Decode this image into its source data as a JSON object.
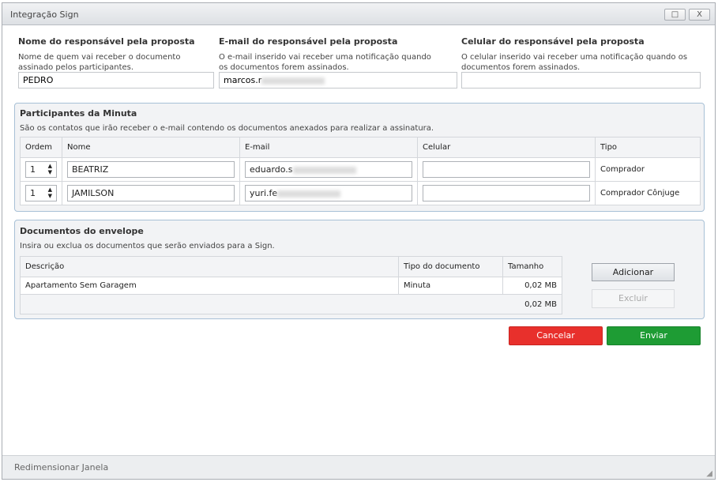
{
  "window": {
    "title": "Integração Sign",
    "maximize_icon": "□",
    "close_icon": "X"
  },
  "responsavel": {
    "nome": {
      "label": "Nome do responsável pela proposta",
      "hint": "Nome de quem vai receber o documento assinado pelos participantes.",
      "value": "PEDRO"
    },
    "email": {
      "label": "E-mail do responsável pela proposta",
      "hint": "O e-mail inserido vai receber uma notificação quando os documentos forem assinados.",
      "value": "marcos.r"
    },
    "celular": {
      "label": "Celular do responsável pela proposta",
      "hint": "O celular inserido vai receber uma notificação quando os documentos forem assinados.",
      "value": ""
    }
  },
  "participantes": {
    "title": "Participantes da Minuta",
    "hint": "São os contatos que irão receber o e-mail contendo os documentos anexados para realizar a assinatura.",
    "columns": [
      "Ordem",
      "Nome",
      "E-mail",
      "Celular",
      "Tipo"
    ],
    "rows": [
      {
        "ordem": "1",
        "nome": "BEATRIZ",
        "email": "eduardo.s",
        "celular": "",
        "tipo": "Comprador"
      },
      {
        "ordem": "1",
        "nome": "JAMILSON",
        "email": "yuri.fe",
        "celular": "",
        "tipo": "Comprador Cônjuge"
      }
    ]
  },
  "documentos": {
    "title": "Documentos do envelope",
    "hint": "Insira ou exclua os documentos que serão enviados para a Sign.",
    "columns": [
      "Descrição",
      "Tipo do documento",
      "Tamanho"
    ],
    "rows": [
      {
        "descricao": "Apartamento Sem Garagem",
        "tipo": "Minuta",
        "tamanho": "0,02 MB"
      }
    ],
    "total": "0,02 MB",
    "add_label": "Adicionar",
    "delete_label": "Excluir"
  },
  "actions": {
    "cancel_label": "Cancelar",
    "send_label": "Enviar",
    "cancel_color": "#e8302c",
    "send_color": "#1e9c34"
  },
  "footer": {
    "resize_label": "Redimensionar Janela"
  }
}
